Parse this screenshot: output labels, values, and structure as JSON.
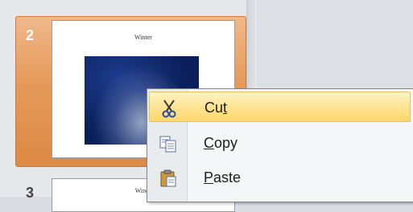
{
  "thumbnails": [
    {
      "number": "2",
      "title": "Winter",
      "selected": true
    },
    {
      "number": "3",
      "title": "Winds",
      "selected": false
    }
  ],
  "context_menu": {
    "items": [
      {
        "label": "Cut",
        "mnemonic_before": "Cu",
        "mnemonic_char": "t",
        "mnemonic_after": "",
        "icon": "scissors-icon",
        "highlighted": true
      },
      {
        "label": "Copy",
        "mnemonic_before": "",
        "mnemonic_char": "C",
        "mnemonic_after": "opy",
        "icon": "copy-icon",
        "highlighted": false
      },
      {
        "label": "Paste",
        "mnemonic_before": "",
        "mnemonic_char": "P",
        "mnemonic_after": "aste",
        "icon": "paste-icon",
        "highlighted": false
      }
    ]
  },
  "colors": {
    "selection_orange": "#e59a5a",
    "menu_hover": "#ffe28f"
  }
}
